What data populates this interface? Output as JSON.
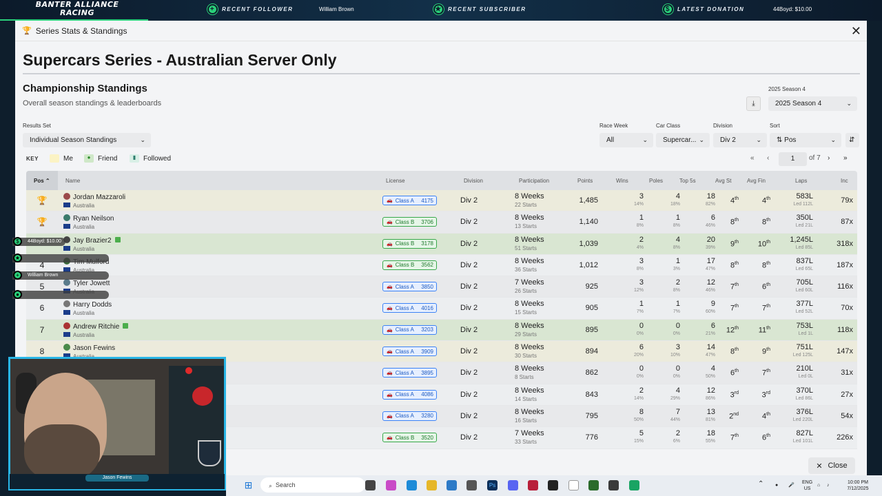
{
  "topbar": {
    "brand": "BANTER ALLIANCE RACING",
    "recent_follower_label": "RECENT FOLLOWER",
    "recent_follower": "William Brown",
    "recent_subscriber_label": "RECENT SUBSCRIBER",
    "latest_donation_label": "LATEST DONATION",
    "latest_donation": "44Boyd: $10.00"
  },
  "dialog": {
    "title": "Series Stats & Standings",
    "series_title": "Supercars Series - Australian Server Only",
    "section_title": "Championship Standings",
    "section_subtitle": "Overall season standings & leaderboards",
    "close_label": "Close"
  },
  "filters": {
    "season_label": "2025 Season 4",
    "season_value": "2025 Season 4",
    "results_set_label": "Results Set",
    "results_set_value": "Individual Season Standings",
    "race_week_label": "Race Week",
    "race_week_value": "All",
    "car_class_label": "Car Class",
    "car_class_value": "Supercar...",
    "division_label": "Division",
    "division_value": "Div 2",
    "sort_label": "Sort",
    "sort_value": "Pos"
  },
  "key": {
    "label": "KEY",
    "me": "Me",
    "friend": "Friend",
    "followed": "Followed"
  },
  "pager": {
    "page": "1",
    "of": "of 7"
  },
  "columns": {
    "pos": "Pos",
    "name": "Name",
    "license": "License",
    "division": "Division",
    "participation": "Participation",
    "points": "Points",
    "wins": "Wins",
    "poles": "Poles",
    "top5s": "Top 5s",
    "avg_st": "Avg St",
    "avg_fin": "Avg Fin",
    "laps": "Laps",
    "inc": "Inc"
  },
  "rows": [
    {
      "pos": "",
      "name": "Jordan Mazzaroli",
      "country": "Australia",
      "lic": "Class A",
      "licnum": "4175",
      "div": "Div 2",
      "weeks": "8 Weeks",
      "starts": "22 Starts",
      "points": "1,485",
      "wins": "3",
      "winsp": "14%",
      "poles": "4",
      "polesp": "18%",
      "top5": "18",
      "top5p": "82%",
      "avgst": "4",
      "avgsts": "th",
      "avgfin": "4",
      "avgfins": "th",
      "laps": "583L",
      "led": "Led 112L",
      "inc": "79x"
    },
    {
      "pos": "",
      "name": "Ryan Neilson",
      "country": "Australia",
      "lic": "Class B",
      "licnum": "3706",
      "div": "Div 2",
      "weeks": "8 Weeks",
      "starts": "13 Starts",
      "points": "1,140",
      "wins": "1",
      "winsp": "8%",
      "poles": "1",
      "polesp": "8%",
      "top5": "6",
      "top5p": "46%",
      "avgst": "8",
      "avgsts": "th",
      "avgfin": "8",
      "avgfins": "th",
      "laps": "350L",
      "led": "Led 21L",
      "inc": "87x"
    },
    {
      "pos": "",
      "name": "Jay Brazier2",
      "country": "Australia",
      "lic": "Class B",
      "licnum": "3178",
      "div": "Div 2",
      "weeks": "8 Weeks",
      "starts": "51 Starts",
      "points": "1,039",
      "wins": "2",
      "winsp": "4%",
      "poles": "4",
      "polesp": "8%",
      "top5": "20",
      "top5p": "39%",
      "avgst": "9",
      "avgsts": "th",
      "avgfin": "10",
      "avgfins": "th",
      "laps": "1,245L",
      "led": "Led 85L",
      "inc": "318x"
    },
    {
      "pos": "4",
      "name": "Tim Mulford",
      "country": "Australia",
      "lic": "Class B",
      "licnum": "3562",
      "div": "Div 2",
      "weeks": "8 Weeks",
      "starts": "36 Starts",
      "points": "1,012",
      "wins": "3",
      "winsp": "8%",
      "poles": "1",
      "polesp": "3%",
      "top5": "17",
      "top5p": "47%",
      "avgst": "8",
      "avgsts": "th",
      "avgfin": "8",
      "avgfins": "th",
      "laps": "837L",
      "led": "Led 65L",
      "inc": "187x"
    },
    {
      "pos": "5",
      "name": "Tyler Jowett",
      "country": "Australia",
      "lic": "Class A",
      "licnum": "3850",
      "div": "Div 2",
      "weeks": "7 Weeks",
      "starts": "26 Starts",
      "points": "925",
      "wins": "3",
      "winsp": "12%",
      "poles": "2",
      "polesp": "8%",
      "top5": "12",
      "top5p": "46%",
      "avgst": "7",
      "avgsts": "th",
      "avgfin": "6",
      "avgfins": "th",
      "laps": "705L",
      "led": "Led 60L",
      "inc": "116x"
    },
    {
      "pos": "6",
      "name": "Harry Dodds",
      "country": "Australia",
      "lic": "Class A",
      "licnum": "4016",
      "div": "Div 2",
      "weeks": "8 Weeks",
      "starts": "15 Starts",
      "points": "905",
      "wins": "1",
      "winsp": "7%",
      "poles": "1",
      "polesp": "7%",
      "top5": "9",
      "top5p": "60%",
      "avgst": "7",
      "avgsts": "th",
      "avgfin": "7",
      "avgfins": "th",
      "laps": "377L",
      "led": "Led 52L",
      "inc": "70x"
    },
    {
      "pos": "7",
      "name": "Andrew Ritchie",
      "country": "Australia",
      "lic": "Class A",
      "licnum": "3203",
      "div": "Div 2",
      "weeks": "8 Weeks",
      "starts": "29 Starts",
      "points": "895",
      "wins": "0",
      "winsp": "0%",
      "poles": "0",
      "polesp": "0%",
      "top5": "6",
      "top5p": "21%",
      "avgst": "12",
      "avgsts": "th",
      "avgfin": "11",
      "avgfins": "th",
      "laps": "753L",
      "led": "Led 1L",
      "inc": "118x"
    },
    {
      "pos": "8",
      "name": "Jason Fewins",
      "country": "Australia",
      "lic": "Class A",
      "licnum": "3909",
      "div": "Div 2",
      "weeks": "8 Weeks",
      "starts": "30 Starts",
      "points": "894",
      "wins": "6",
      "winsp": "20%",
      "poles": "3",
      "polesp": "10%",
      "top5": "14",
      "top5p": "47%",
      "avgst": "8",
      "avgsts": "th",
      "avgfin": "9",
      "avgfins": "th",
      "laps": "751L",
      "led": "Led 125L",
      "inc": "147x"
    },
    {
      "pos": "",
      "name": "",
      "country": "",
      "lic": "Class A",
      "licnum": "3895",
      "div": "Div 2",
      "weeks": "8 Weeks",
      "starts": "8 Starts",
      "points": "862",
      "wins": "0",
      "winsp": "0%",
      "poles": "0",
      "polesp": "0%",
      "top5": "4",
      "top5p": "50%",
      "avgst": "6",
      "avgsts": "th",
      "avgfin": "7",
      "avgfins": "th",
      "laps": "210L",
      "led": "Led 0L",
      "inc": "31x"
    },
    {
      "pos": "",
      "name": "",
      "country": "",
      "lic": "Class A",
      "licnum": "4086",
      "div": "Div 2",
      "weeks": "8 Weeks",
      "starts": "14 Starts",
      "points": "843",
      "wins": "2",
      "winsp": "14%",
      "poles": "4",
      "polesp": "29%",
      "top5": "12",
      "top5p": "86%",
      "avgst": "3",
      "avgsts": "rd",
      "avgfin": "3",
      "avgfins": "rd",
      "laps": "370L",
      "led": "Led 86L",
      "inc": "27x"
    },
    {
      "pos": "",
      "name": "",
      "country": "",
      "lic": "Class A",
      "licnum": "3280",
      "div": "Div 2",
      "weeks": "8 Weeks",
      "starts": "16 Starts",
      "points": "795",
      "wins": "8",
      "winsp": "50%",
      "poles": "7",
      "polesp": "44%",
      "top5": "13",
      "top5p": "81%",
      "avgst": "2",
      "avgsts": "nd",
      "avgfin": "4",
      "avgfins": "th",
      "laps": "376L",
      "led": "Led 220L",
      "inc": "54x"
    },
    {
      "pos": "",
      "name": "",
      "country": "",
      "lic": "Class B",
      "licnum": "3520",
      "div": "Div 2",
      "weeks": "7 Weeks",
      "starts": "33 Starts",
      "points": "776",
      "wins": "5",
      "winsp": "15%",
      "poles": "2",
      "polesp": "6%",
      "top5": "18",
      "top5p": "55%",
      "avgst": "7",
      "avgsts": "th",
      "avgfin": "6",
      "avgfins": "th",
      "laps": "827L",
      "led": "Led 101L",
      "inc": "226x"
    }
  ],
  "overlay": {
    "donation": "44Boyd: $10.00",
    "follower": "William Brown",
    "cam_name": "Jason Fewins"
  },
  "taskbar": {
    "search": "Search",
    "lang1": "ENG",
    "lang2": "US",
    "time": "10:00 PM",
    "date": "7/12/2025"
  }
}
